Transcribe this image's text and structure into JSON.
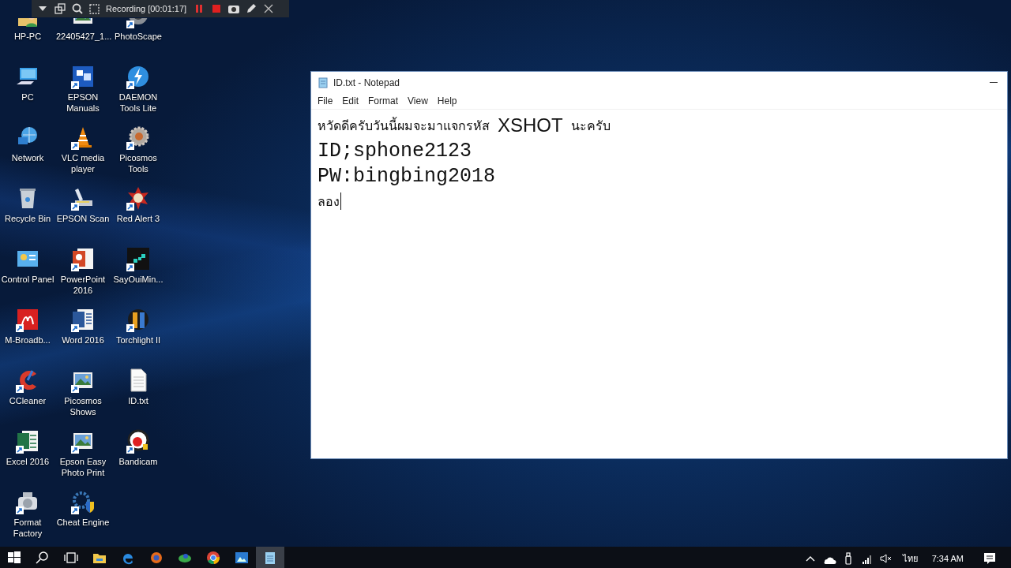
{
  "recorder": {
    "tools_left": [
      {
        "kind": "dropdown"
      },
      {
        "kind": "window"
      },
      {
        "kind": "search"
      },
      {
        "kind": "region"
      }
    ],
    "status": "Recording [00:01:17]",
    "tools_right": [
      {
        "kind": "pause"
      },
      {
        "kind": "stop"
      },
      {
        "kind": "camera"
      },
      {
        "kind": "pencil"
      },
      {
        "kind": "close"
      }
    ]
  },
  "desktop_icons": [
    {
      "label": "HP-PC",
      "kind": "user",
      "shortcut": false
    },
    {
      "label": "22405427_1...",
      "kind": "photo",
      "shortcut": false
    },
    {
      "label": "PhotoScape",
      "kind": "app",
      "shortcut": true
    },
    {
      "label": "PC",
      "kind": "computer",
      "shortcut": false
    },
    {
      "label": "EPSON Manuals",
      "kind": "book",
      "shortcut": true
    },
    {
      "label": "DAEMON Tools Lite",
      "kind": "disc",
      "shortcut": true
    },
    {
      "label": "Network",
      "kind": "globe",
      "shortcut": false
    },
    {
      "label": "VLC media player",
      "kind": "cone",
      "shortcut": true
    },
    {
      "label": "Picosmos Tools",
      "kind": "gear",
      "shortcut": true
    },
    {
      "label": "Recycle Bin",
      "kind": "bin",
      "shortcut": false
    },
    {
      "label": "EPSON Scan",
      "kind": "scanner",
      "shortcut": true
    },
    {
      "label": "Red Alert 3",
      "kind": "star",
      "shortcut": true
    },
    {
      "label": "Control Panel",
      "kind": "panel",
      "shortcut": false
    },
    {
      "label": "PowerPoint 2016",
      "kind": "slides",
      "shortcut": true
    },
    {
      "label": "SayOuiMin...",
      "kind": "game",
      "shortcut": true
    },
    {
      "label": "M-Broadb...",
      "kind": "tile",
      "shortcut": true
    },
    {
      "label": "Word 2016",
      "kind": "doc",
      "shortcut": true
    },
    {
      "label": "Torchlight II",
      "kind": "emblem",
      "shortcut": true
    },
    {
      "label": "CCleaner",
      "kind": "crescent",
      "shortcut": true
    },
    {
      "label": "Picosmos Shows",
      "kind": "photo",
      "shortcut": true
    },
    {
      "label": "ID.txt",
      "kind": "textfile",
      "shortcut": false
    },
    {
      "label": "Excel 2016",
      "kind": "sheet",
      "shortcut": true
    },
    {
      "label": "Epson Easy Photo Print",
      "kind": "photo",
      "shortcut": true
    },
    {
      "label": "Bandicam",
      "kind": "record",
      "shortcut": true
    },
    {
      "label": "Format Factory",
      "kind": "factory",
      "shortcut": true
    },
    {
      "label": "Cheat Engine",
      "kind": "engine",
      "shortcut": true
    }
  ],
  "notepad": {
    "title": "ID.txt - Notepad",
    "menu": [
      "File",
      "Edit",
      "Format",
      "View",
      "Help"
    ],
    "lines": [
      {
        "segments": [
          {
            "text": "หวัดดีครับวันนี้ผมจะมาแจกรหัส",
            "kind": "normal"
          },
          {
            "text": "XSHOT",
            "kind": "large"
          },
          {
            "text": "นะครับ",
            "kind": "normal"
          }
        ],
        "caret": false
      },
      {
        "segments": [
          {
            "text": "ID;sphone2123",
            "kind": "mono"
          }
        ],
        "caret": false
      },
      {
        "segments": [
          {
            "text": "PW:bingbing2018",
            "kind": "mono"
          }
        ],
        "caret": false
      },
      {
        "segments": [
          {
            "text": "ลอง",
            "kind": "normal"
          }
        ],
        "caret": true
      }
    ]
  },
  "taskbar": {
    "items": [
      {
        "kind": "start",
        "selected": false
      },
      {
        "kind": "search",
        "selected": false
      },
      {
        "kind": "taskview",
        "selected": false
      },
      {
        "kind": "explorer",
        "selected": false
      },
      {
        "kind": "edge",
        "selected": false
      },
      {
        "kind": "firefox",
        "selected": false
      },
      {
        "kind": "green",
        "selected": false
      },
      {
        "kind": "chrome",
        "selected": false
      },
      {
        "kind": "photo",
        "selected": false
      },
      {
        "kind": "notepad",
        "selected": true
      }
    ],
    "tray": [
      {
        "kind": "chevron"
      },
      {
        "kind": "cloud"
      },
      {
        "kind": "usb"
      },
      {
        "kind": "signal"
      },
      {
        "kind": "mute"
      }
    ],
    "language": "ไทย",
    "clock": "7:34 AM"
  }
}
